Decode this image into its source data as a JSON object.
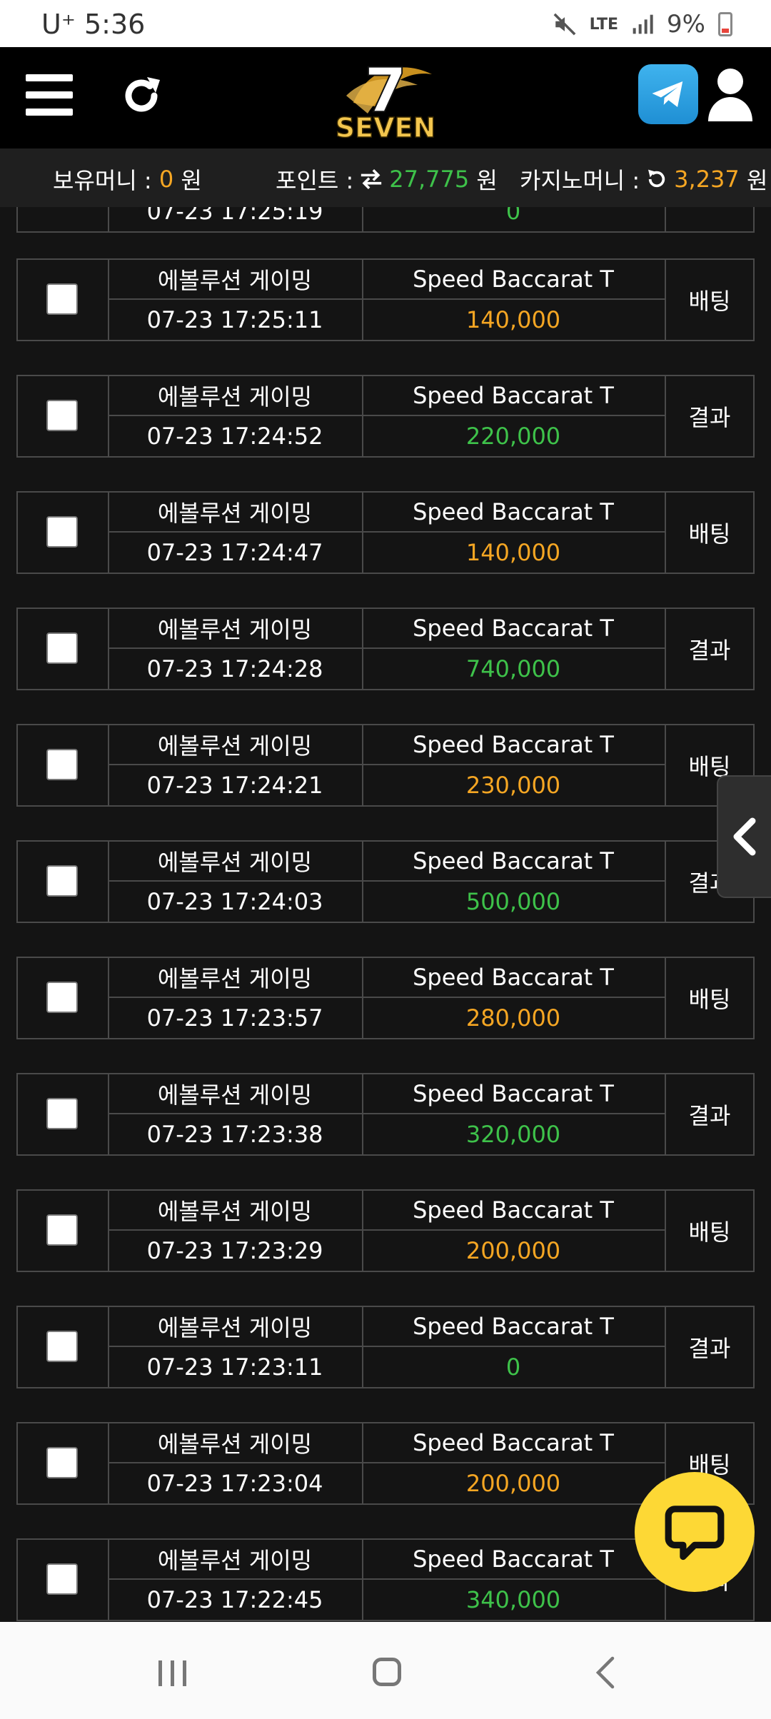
{
  "status_bar": {
    "carrier": "U⁺",
    "time": "5:36",
    "network": "LTE",
    "battery": "9%"
  },
  "money_bar": {
    "holding_label": "보유머니 :",
    "holding_value": "0",
    "holding_unit": "원",
    "point_label": "포인트 :",
    "point_value": "27,775",
    "point_unit": "원",
    "casino_label": "카지노머니 :",
    "casino_value": "3,237",
    "casino_unit": "원"
  },
  "partial_row": {
    "time": "07-23 17:25:19",
    "amount": "0"
  },
  "rows": [
    {
      "provider": "에볼루션 게이밍",
      "time": "07-23 17:25:11",
      "game": "Speed Baccarat T",
      "amount": "140,000",
      "type": "배팅"
    },
    {
      "provider": "에볼루션 게이밍",
      "time": "07-23 17:24:52",
      "game": "Speed Baccarat T",
      "amount": "220,000",
      "type": "결과"
    },
    {
      "provider": "에볼루션 게이밍",
      "time": "07-23 17:24:47",
      "game": "Speed Baccarat T",
      "amount": "140,000",
      "type": "배팅"
    },
    {
      "provider": "에볼루션 게이밍",
      "time": "07-23 17:24:28",
      "game": "Speed Baccarat T",
      "amount": "740,000",
      "type": "결과"
    },
    {
      "provider": "에볼루션 게이밍",
      "time": "07-23 17:24:21",
      "game": "Speed Baccarat T",
      "amount": "230,000",
      "type": "배팅"
    },
    {
      "provider": "에볼루션 게이밍",
      "time": "07-23 17:24:03",
      "game": "Speed Baccarat T",
      "amount": "500,000",
      "type": "결과"
    },
    {
      "provider": "에볼루션 게이밍",
      "time": "07-23 17:23:57",
      "game": "Speed Baccarat T",
      "amount": "280,000",
      "type": "배팅"
    },
    {
      "provider": "에볼루션 게이밍",
      "time": "07-23 17:23:38",
      "game": "Speed Baccarat T",
      "amount": "320,000",
      "type": "결과"
    },
    {
      "provider": "에볼루션 게이밍",
      "time": "07-23 17:23:29",
      "game": "Speed Baccarat T",
      "amount": "200,000",
      "type": "배팅"
    },
    {
      "provider": "에볼루션 게이밍",
      "time": "07-23 17:23:11",
      "game": "Speed Baccarat T",
      "amount": "0",
      "type": "결과"
    },
    {
      "provider": "에볼루션 게이밍",
      "time": "07-23 17:23:04",
      "game": "Speed Baccarat T",
      "amount": "200,000",
      "type": "배팅"
    },
    {
      "provider": "에볼루션 게이밍",
      "time": "07-23 17:22:45",
      "game": "Speed Baccarat T",
      "amount": "340,000",
      "type": "결과"
    }
  ],
  "colors": {
    "bet": "#f5a623",
    "result": "#3ec24a",
    "chat": "#fdd835"
  },
  "icons": [
    "menu-icon",
    "refresh-icon",
    "telegram-icon",
    "user-icon",
    "chevron-left-icon",
    "chat-icon"
  ]
}
